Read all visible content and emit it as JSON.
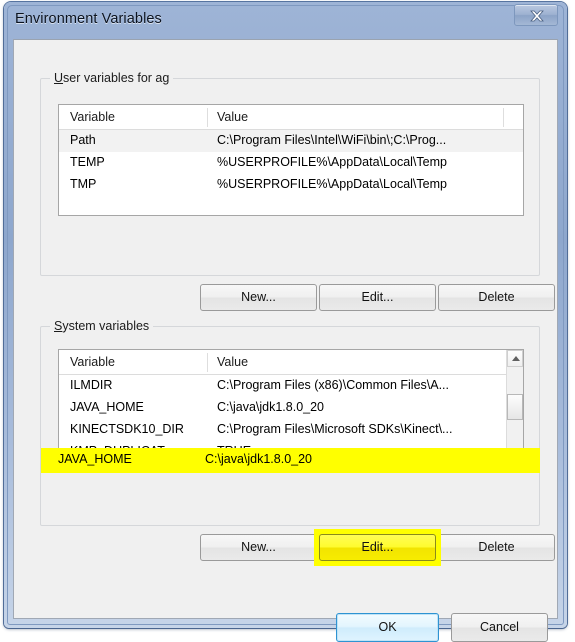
{
  "window": {
    "title": "Environment Variables",
    "close_label": "x"
  },
  "user_section": {
    "label_accel": "U",
    "label_rest": "ser variables for ag",
    "columns": [
      "Variable",
      "Value"
    ],
    "rows": [
      {
        "variable": "Path",
        "value": "C:\\Program Files\\Intel\\WiFi\\bin\\;C:\\Prog...",
        "selected": true
      },
      {
        "variable": "TEMP",
        "value": "%USERPROFILE%\\AppData\\Local\\Temp",
        "selected": false
      },
      {
        "variable": "TMP",
        "value": "%USERPROFILE%\\AppData\\Local\\Temp",
        "selected": false
      }
    ],
    "buttons": {
      "new_accel": "N",
      "new_pre": "",
      "new_post": "ew...",
      "new_label": "New...",
      "edit_label": "Edit...",
      "edit_accel": "E",
      "edit_post": "dit...",
      "delete_label": "Delete",
      "delete_accel": "D",
      "delete_post": "elete"
    }
  },
  "system_section": {
    "label_accel": "S",
    "label_rest": "ystem variables",
    "columns": [
      "Variable",
      "Value"
    ],
    "rows": [
      {
        "variable": "ILMDIR",
        "value": "C:\\Program Files (x86)\\Common Files\\A...",
        "highlighted": false
      },
      {
        "variable": "JAVA_HOME",
        "value": "C:\\java\\jdk1.8.0_20",
        "highlighted": true
      },
      {
        "variable": "KINECTSDK10_DIR",
        "value": "C:\\Program Files\\Microsoft SDKs\\Kinect\\...",
        "highlighted": false
      },
      {
        "variable": "KMP_DUPLICAT...",
        "value": "TRUE",
        "highlighted": false
      }
    ],
    "buttons": {
      "new_label": "New...",
      "edit_label": "Edit...",
      "delete_label": "Delete"
    }
  },
  "dialog_buttons": {
    "ok_label": "OK",
    "cancel_label": "Cancel"
  },
  "annotations": {
    "highlight_color": "#ffff00",
    "highlighted_row": "JAVA_HOME",
    "highlighted_button": "Edit..."
  }
}
